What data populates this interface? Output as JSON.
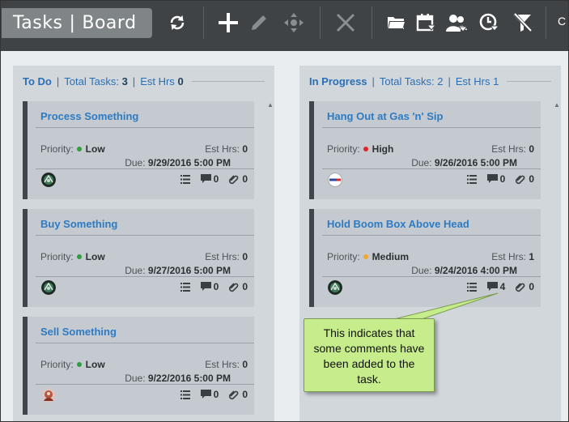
{
  "toolbar": {
    "title_left": "Tasks",
    "title_sep": "|",
    "title_right": "Board",
    "overflow_label": "C",
    "icons": [
      "refresh-icon",
      "add-icon",
      "edit-icon",
      "move-icon",
      "delete-icon",
      "folder-icon",
      "calendar-icon",
      "users-icon",
      "clock-icon",
      "clear-filter-icon"
    ]
  },
  "columns": [
    {
      "name": "To Do",
      "total_label": "Total Tasks:",
      "total_value": "3",
      "est_label": "Est Hrs",
      "est_value": "0",
      "cards": [
        {
          "title": "Process Something",
          "priority_label": "Priority:",
          "priority": "Low",
          "priority_color": "#2e9e3e",
          "est_label": "Est Hrs:",
          "est_value": "0",
          "due_label": "Due:",
          "due_value": "9/29/2016 5:00 PM",
          "avatar": "avatar-green",
          "comments": "0",
          "attachments": "0"
        },
        {
          "title": "Buy Something",
          "priority_label": "Priority:",
          "priority": "Low",
          "priority_color": "#2e9e3e",
          "est_label": "Est Hrs:",
          "est_value": "0",
          "due_label": "Due:",
          "due_value": "9/27/2016 5:00 PM",
          "avatar": "avatar-green",
          "comments": "0",
          "attachments": "0"
        },
        {
          "title": "Sell Something",
          "priority_label": "Priority:",
          "priority": "Low",
          "priority_color": "#2e9e3e",
          "est_label": "Est Hrs:",
          "est_value": "0",
          "due_label": "Due:",
          "due_value": "9/22/2016 5:00 PM",
          "avatar": "avatar-red",
          "comments": "0",
          "attachments": "0"
        }
      ]
    },
    {
      "name": "In Progress",
      "total_label": "Total Tasks:",
      "total_value": "2",
      "est_label": "Est Hrs",
      "est_value": "1",
      "cards": [
        {
          "title": "Hang Out at Gas 'n' Sip",
          "priority_label": "Priority:",
          "priority": "High",
          "priority_color": "#e0242c",
          "est_label": "Est Hrs:",
          "est_value": "0",
          "due_label": "Due:",
          "due_value": "9/26/2016 5:00 PM",
          "avatar": "avatar-logo",
          "comments": "0",
          "attachments": "0"
        },
        {
          "title": "Hold Boom Box Above Head",
          "priority_label": "Priority:",
          "priority": "Medium",
          "priority_color": "#f2a531",
          "est_label": "Est Hrs:",
          "est_value": "1",
          "due_label": "Due:",
          "due_value": "9/24/2016 4:00 PM",
          "avatar": "avatar-green",
          "comments": "4",
          "attachments": "0"
        }
      ]
    }
  ],
  "callout": {
    "text": "This indicates that some comments have been added to the task."
  }
}
